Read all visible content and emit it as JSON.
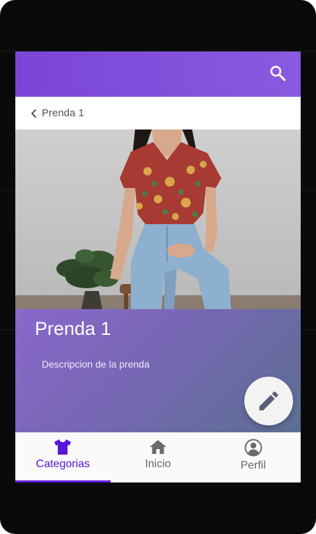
{
  "header": {
    "search_icon": "search-icon"
  },
  "breadcrumb": {
    "back_icon": "chevron-left-icon",
    "label": "Prenda 1"
  },
  "item": {
    "title": "Prenda 1",
    "description": "Descripcion de la prenda",
    "edit_icon": "pencil-icon"
  },
  "bottom_nav": {
    "items": [
      {
        "label": "Categorias",
        "icon": "tshirt-icon",
        "active": true
      },
      {
        "label": "Inicio",
        "icon": "home-icon",
        "active": false
      },
      {
        "label": "Perfil",
        "icon": "user-circle-icon",
        "active": false
      }
    ]
  },
  "colors": {
    "appbar": "#7b45d8",
    "accent": "#5a14d8",
    "inactive": "#666666",
    "fab_bg": "#f3f3f3"
  }
}
